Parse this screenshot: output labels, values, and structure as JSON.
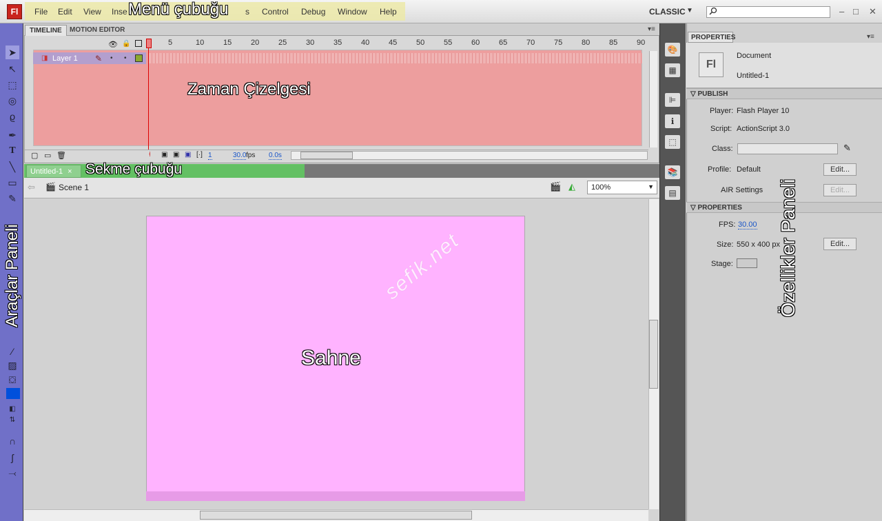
{
  "app": {
    "logo": "Fl",
    "workspace": "CLASSIC"
  },
  "menu": {
    "items": [
      "File",
      "Edit",
      "View",
      "Inse",
      "s",
      "Control",
      "Debug",
      "Window",
      "Help"
    ],
    "annotation": "Menü çubuğu",
    "highlight_color": "#ece9a8"
  },
  "window_controls": {
    "minimize": "–",
    "maximize": "□",
    "close": "✕"
  },
  "tools": {
    "annotation": "Araçlar Paneli",
    "panel_color": "#7070c8"
  },
  "timeline": {
    "tabs": [
      "TIMELINE",
      "MOTION EDITOR"
    ],
    "ruler": [
      "1",
      "5",
      "10",
      "15",
      "20",
      "25",
      "30",
      "35",
      "40",
      "45",
      "50",
      "55",
      "60",
      "65",
      "70",
      "75",
      "80",
      "85",
      "90"
    ],
    "layer_name": "Layer 1",
    "annotation": "Zaman Çizelgesi",
    "current_frame": "1",
    "fps": "30.0",
    "fps_unit": "fps",
    "elapsed": "0.0s",
    "area_color": "#ed9e9e"
  },
  "document_tabs": {
    "active": "Untitled-1",
    "close": "×",
    "annotation": "Sekme çubuğu",
    "highlight_color": "#63c063"
  },
  "editbar": {
    "scene": "Scene 1",
    "zoom": "100%"
  },
  "stage": {
    "annotation": "Sahne",
    "watermark": "sefik.net",
    "color": "#ffb3ff"
  },
  "properties": {
    "tab": "PROPERTIES",
    "doc_icon": "Fl",
    "doc_type": "Document",
    "doc_name": "Untitled-1",
    "section_publish": "PUBLISH",
    "player_label": "Player:",
    "player_value": "Flash Player 10",
    "script_label": "Script:",
    "script_value": "ActionScript 3.0",
    "class_label": "Class:",
    "profile_label": "Profile:",
    "profile_value": "Default",
    "edit": "Edit...",
    "air_label": "AIR Settings",
    "section_properties": "PROPERTIES",
    "fps_label": "FPS:",
    "fps_value": "30.00",
    "size_label": "Size:",
    "size_value": "550 x 400 px",
    "stage_label": "Stage:",
    "annotation": "Özellikler Paneli"
  }
}
